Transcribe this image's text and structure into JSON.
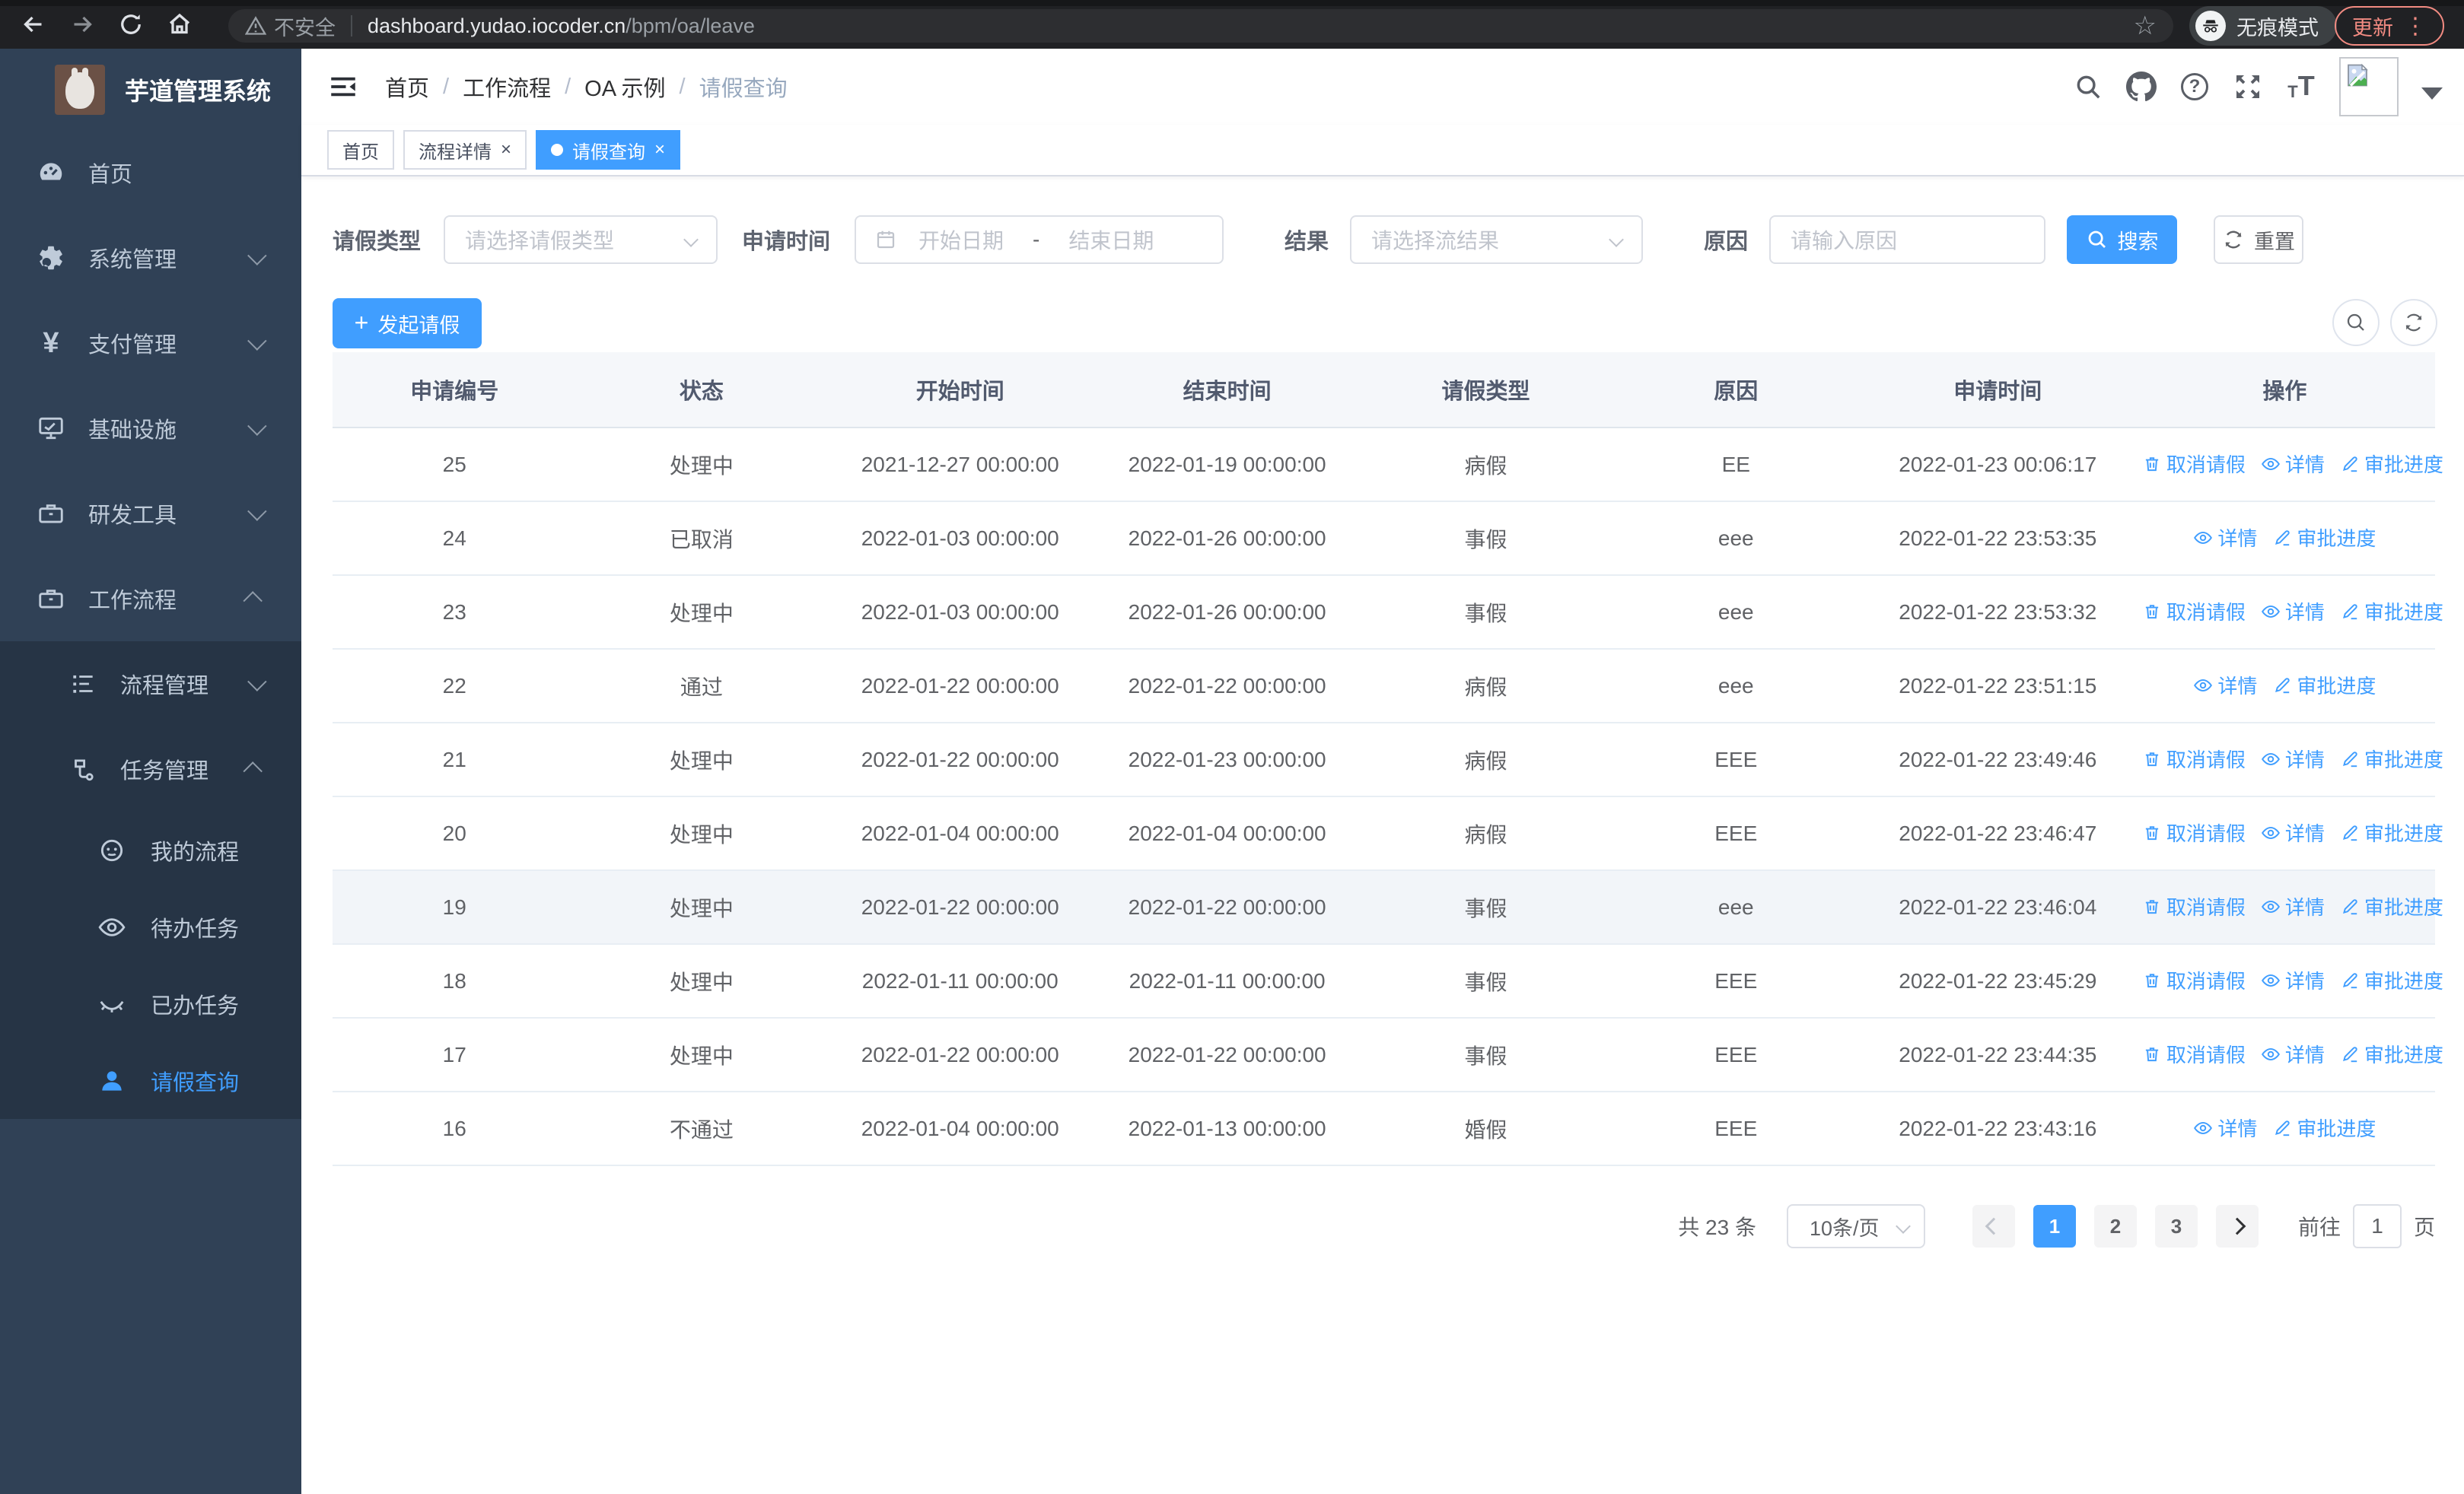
{
  "browser": {
    "security_label": "不安全",
    "url_host": "dashboard.yudao.iocoder.cn",
    "url_path": "/bpm/oa/leave",
    "incognito_label": "无痕模式",
    "update_label": "更新"
  },
  "sidebar": {
    "app_title": "芋道管理系统",
    "items": [
      {
        "label": "首页",
        "icon": "dashboard-icon"
      },
      {
        "label": "系统管理",
        "icon": "gear-icon"
      },
      {
        "label": "支付管理",
        "icon": "yen-icon"
      },
      {
        "label": "基础设施",
        "icon": "monitor-icon"
      },
      {
        "label": "研发工具",
        "icon": "toolbox-icon"
      },
      {
        "label": "工作流程",
        "icon": "briefcase-icon"
      },
      {
        "label": "流程管理",
        "icon": "tree-list-icon"
      },
      {
        "label": "任务管理",
        "icon": "flow-icon"
      },
      {
        "label": "我的流程",
        "icon": "robot-face-icon"
      },
      {
        "label": "待办任务",
        "icon": "eye-open-icon"
      },
      {
        "label": "已办任务",
        "icon": "eye-closed-icon"
      },
      {
        "label": "请假查询",
        "icon": "person-icon",
        "active": true
      }
    ]
  },
  "header": {
    "breadcrumbs": [
      "首页",
      "工作流程",
      "OA 示例",
      "请假查询"
    ]
  },
  "tabs": [
    {
      "label": "首页",
      "closable": false,
      "active": false
    },
    {
      "label": "流程详情",
      "closable": true,
      "active": false
    },
    {
      "label": "请假查询",
      "closable": true,
      "active": true
    }
  ],
  "filters": {
    "leave_type_label": "请假类型",
    "leave_type_placeholder": "请选择请假类型",
    "apply_time_label": "申请时间",
    "start_date_placeholder": "开始日期",
    "date_separator": "-",
    "end_date_placeholder": "结束日期",
    "result_label": "结果",
    "result_placeholder": "请选择流结果",
    "reason_label": "原因",
    "reason_placeholder": "请输入原因",
    "search_label": "搜索",
    "reset_label": "重置"
  },
  "toolbar": {
    "create_label": "发起请假"
  },
  "table": {
    "columns": [
      "申请编号",
      "状态",
      "开始时间",
      "结束时间",
      "请假类型",
      "原因",
      "申请时间",
      "操作"
    ],
    "action_labels": {
      "cancel": "取消请假",
      "detail": "详情",
      "progress": "审批进度"
    },
    "rows": [
      {
        "id": "25",
        "status": "处理中",
        "start": "2021-12-27 00:00:00",
        "end": "2022-01-19 00:00:00",
        "type": "病假",
        "reason": "EE",
        "applied": "2022-01-23 00:06:17",
        "cancelable": true,
        "highlight": false
      },
      {
        "id": "24",
        "status": "已取消",
        "start": "2022-01-03 00:00:00",
        "end": "2022-01-26 00:00:00",
        "type": "事假",
        "reason": "eee",
        "applied": "2022-01-22 23:53:35",
        "cancelable": false,
        "highlight": false
      },
      {
        "id": "23",
        "status": "处理中",
        "start": "2022-01-03 00:00:00",
        "end": "2022-01-26 00:00:00",
        "type": "事假",
        "reason": "eee",
        "applied": "2022-01-22 23:53:32",
        "cancelable": true,
        "highlight": false
      },
      {
        "id": "22",
        "status": "通过",
        "start": "2022-01-22 00:00:00",
        "end": "2022-01-22 00:00:00",
        "type": "病假",
        "reason": "eee",
        "applied": "2022-01-22 23:51:15",
        "cancelable": false,
        "highlight": false
      },
      {
        "id": "21",
        "status": "处理中",
        "start": "2022-01-22 00:00:00",
        "end": "2022-01-23 00:00:00",
        "type": "病假",
        "reason": "EEE",
        "applied": "2022-01-22 23:49:46",
        "cancelable": true,
        "highlight": false
      },
      {
        "id": "20",
        "status": "处理中",
        "start": "2022-01-04 00:00:00",
        "end": "2022-01-04 00:00:00",
        "type": "病假",
        "reason": "EEE",
        "applied": "2022-01-22 23:46:47",
        "cancelable": true,
        "highlight": false
      },
      {
        "id": "19",
        "status": "处理中",
        "start": "2022-01-22 00:00:00",
        "end": "2022-01-22 00:00:00",
        "type": "事假",
        "reason": "eee",
        "applied": "2022-01-22 23:46:04",
        "cancelable": true,
        "highlight": true
      },
      {
        "id": "18",
        "status": "处理中",
        "start": "2022-01-11 00:00:00",
        "end": "2022-01-11 00:00:00",
        "type": "事假",
        "reason": "EEE",
        "applied": "2022-01-22 23:45:29",
        "cancelable": true,
        "highlight": false
      },
      {
        "id": "17",
        "status": "处理中",
        "start": "2022-01-22 00:00:00",
        "end": "2022-01-22 00:00:00",
        "type": "事假",
        "reason": "EEE",
        "applied": "2022-01-22 23:44:35",
        "cancelable": true,
        "highlight": false
      },
      {
        "id": "16",
        "status": "不通过",
        "start": "2022-01-04 00:00:00",
        "end": "2022-01-13 00:00:00",
        "type": "婚假",
        "reason": "EEE",
        "applied": "2022-01-22 23:43:16",
        "cancelable": false,
        "highlight": false
      }
    ]
  },
  "pagination": {
    "total_label": "共 23 条",
    "page_size_label": "10条/页",
    "pages": [
      "1",
      "2",
      "3"
    ],
    "active_page": "1",
    "goto_label": "前往",
    "goto_value": "1",
    "page_unit_label": "页"
  },
  "colors": {
    "accent": "#409eff",
    "sidebar_bg": "#304156",
    "submenu_bg": "#263445",
    "sidebar_text": "#bfcbd9",
    "chrome_bg": "#202124",
    "update_badge": "#f28b82",
    "table_header_bg": "#f5f7fa",
    "row_highlight": "#f2f5f9"
  }
}
